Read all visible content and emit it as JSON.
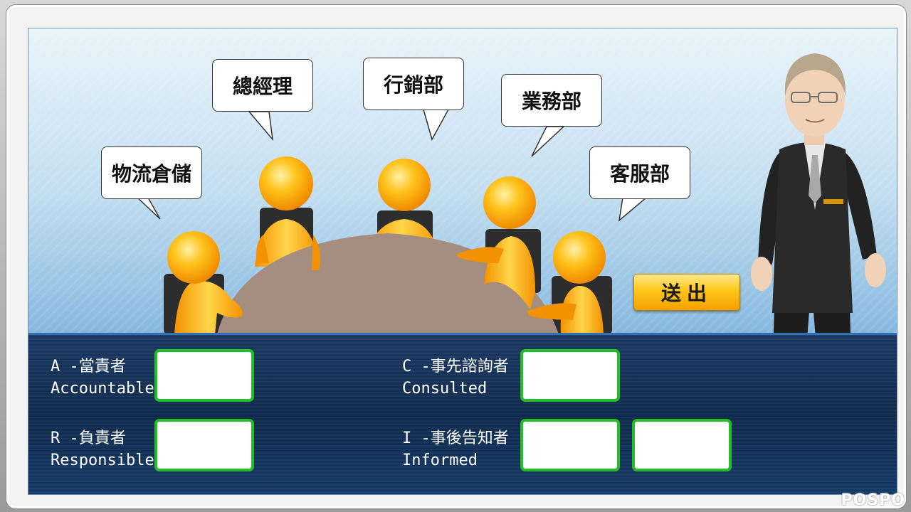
{
  "speech_bubbles": {
    "logistics": "物流倉儲",
    "general_manager": "總經理",
    "marketing": "行銷部",
    "sales": "業務部",
    "customer_service": "客服部"
  },
  "roles": {
    "accountable": {
      "code": "A",
      "cn": "當責者",
      "en": "Accountable"
    },
    "responsible": {
      "code": "R",
      "cn": "負責者",
      "en": "Responsible"
    },
    "consulted": {
      "code": "C",
      "cn": "事先諮詢者",
      "en": "Consulted"
    },
    "informed": {
      "code": "I",
      "cn": "事後告知者",
      "en": "Informed"
    }
  },
  "role_separator": " -",
  "submit_label": "送出",
  "watermark": "POSPO",
  "colors": {
    "drop_border": "#22c024",
    "figure": "#ffb300",
    "table": "#a58d80",
    "panel": "#0f2a4c",
    "button": "#ffc61a"
  }
}
